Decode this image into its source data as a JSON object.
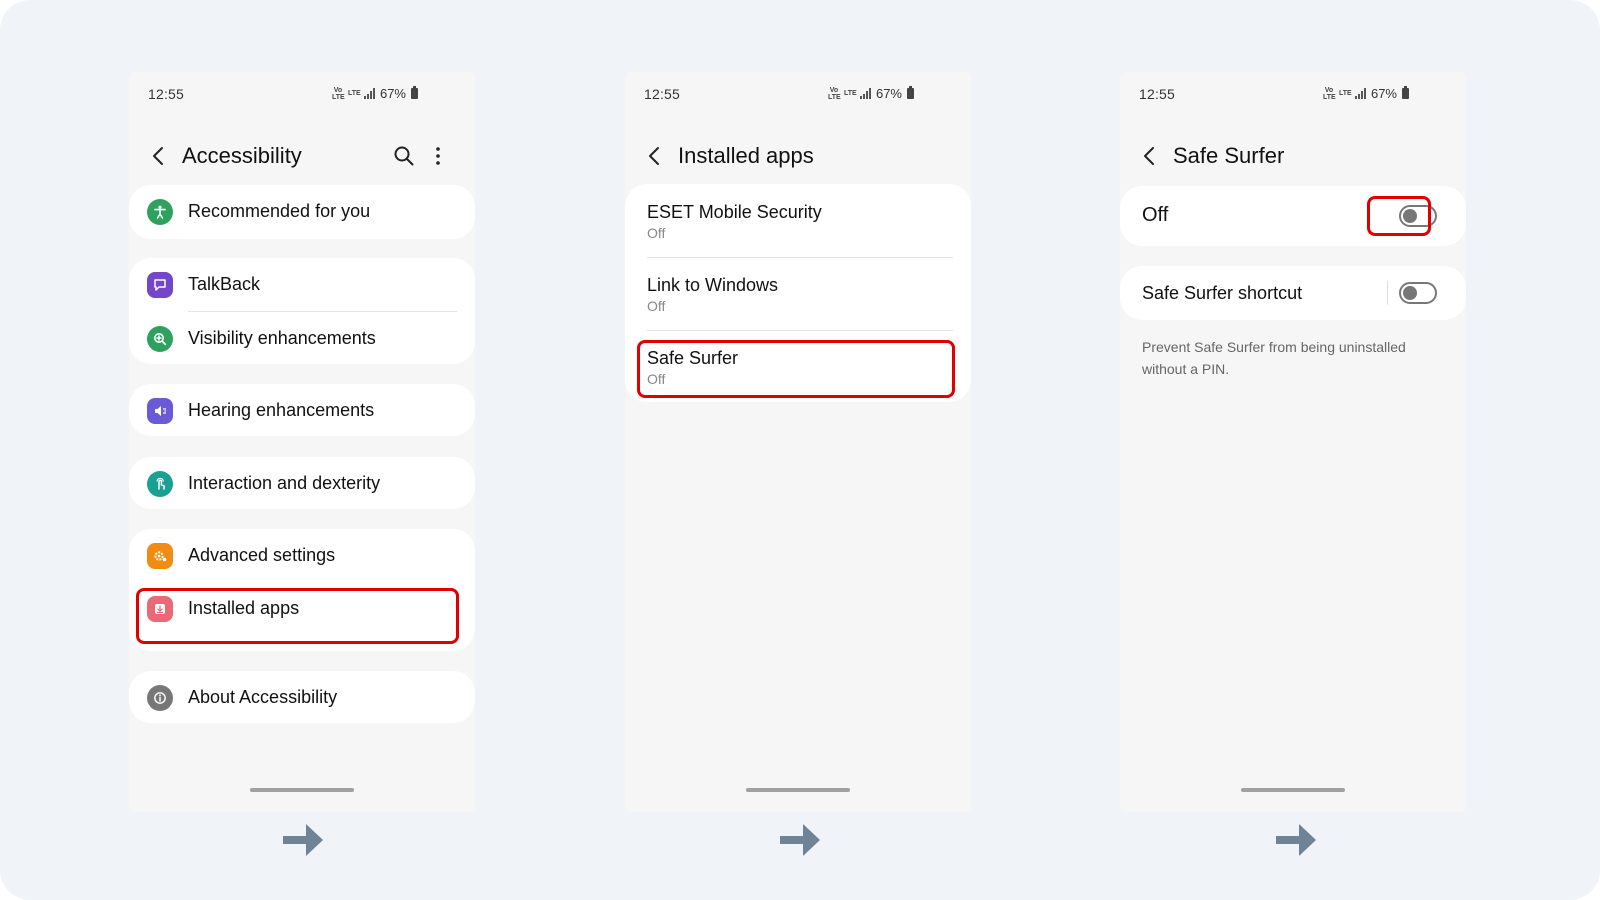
{
  "colors": {
    "highlight": "#e00000",
    "arrow": "#6e8496",
    "recommended_icon": "#2ea15f",
    "talkback_icon": "#7446c8",
    "visibility_icon": "#2ea15f",
    "hearing_icon": "#6a5ad8",
    "interaction_icon": "#1a9f93",
    "advanced_icon": "#f08c14",
    "installed_icon": "#e86a76",
    "about_icon": "#777777"
  },
  "status": {
    "time": "12:55",
    "volte": "Vo) LTE",
    "lte": "LTE",
    "battery": "67%"
  },
  "screen1": {
    "title": "Accessibility",
    "icons": {
      "back": "chevron-left-icon",
      "search": "search-icon",
      "more": "more-vert-icon"
    },
    "groups": [
      {
        "items": [
          {
            "label": "Recommended for you",
            "icon": "accessibility-person-icon"
          }
        ]
      },
      {
        "items": [
          {
            "label": "TalkBack",
            "icon": "chat-bubble-icon"
          },
          {
            "label": "Visibility enhancements",
            "icon": "zoom-in-icon"
          }
        ]
      },
      {
        "items": [
          {
            "label": "Hearing enhancements",
            "icon": "volume-icon"
          }
        ]
      },
      {
        "items": [
          {
            "label": "Interaction and dexterity",
            "icon": "touch-icon"
          }
        ]
      },
      {
        "items": [
          {
            "label": "Advanced settings",
            "icon": "gear-icon"
          },
          {
            "label": "Installed apps",
            "icon": "download-icon",
            "highlighted": true
          }
        ]
      },
      {
        "items": [
          {
            "label": "About Accessibility",
            "icon": "info-icon"
          }
        ]
      }
    ]
  },
  "screen2": {
    "title": "Installed apps",
    "apps": [
      {
        "name": "ESET Mobile Security",
        "status": "Off"
      },
      {
        "name": "Link to Windows",
        "status": "Off"
      },
      {
        "name": "Safe Surfer",
        "status": "Off",
        "highlighted": true
      }
    ]
  },
  "screen3": {
    "title": "Safe Surfer",
    "main_toggle": {
      "label": "Off",
      "on": false,
      "highlighted": true
    },
    "shortcut": {
      "label": "Safe Surfer shortcut",
      "on": false
    },
    "help": "Prevent Safe Surfer from being uninstalled without a PIN."
  }
}
